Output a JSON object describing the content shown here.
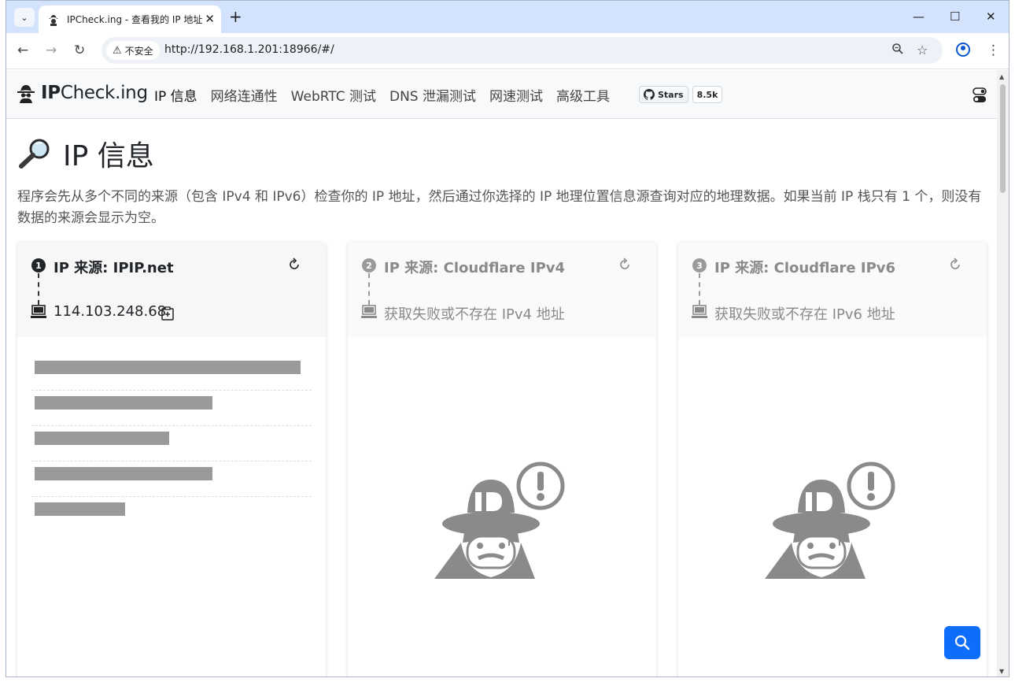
{
  "browser": {
    "tab_title": "IPCheck.ing - 查看我的 IP 地址",
    "tab_close": "✕",
    "new_tab": "+",
    "window_controls": {
      "minimize": "—",
      "maximize": "☐",
      "close": "✕"
    },
    "nav": {
      "back": "←",
      "forward": "→",
      "reload": "↻"
    },
    "security_label": "不安全",
    "url": "http://192.168.1.201:18966/#/",
    "icons": [
      "zoom-icon",
      "star-icon",
      "profile-icon",
      "menu-icon"
    ]
  },
  "site": {
    "brand_bold": "IP",
    "brand_rest": "Check.ing",
    "nav_items": [
      {
        "label": "IP 信息",
        "active": true
      },
      {
        "label": "网络连通性"
      },
      {
        "label": "WebRTC 测试"
      },
      {
        "label": "DNS 泄漏测试"
      },
      {
        "label": "网速测试"
      },
      {
        "label": "高级工具"
      }
    ],
    "github_stars_label": "Stars",
    "github_stars_count": "8.5k"
  },
  "page": {
    "title": "IP 信息",
    "intro": "程序会先从多个不同的来源（包含 IPv4 和 IPv6）检查你的 IP 地址，然后通过你选择的 IP 地理位置信息源查询对应的地理数据。如果当前 IP 栈只有 1 个，则没有数据的来源会显示为空。"
  },
  "cards": [
    {
      "step": "1",
      "source": "IP 来源: IPIP.net",
      "ip": "114.103.248.68",
      "status": "ok",
      "skeleton_rows": [
        0.97,
        0.65,
        0.49,
        0.65,
        0.33
      ]
    },
    {
      "step": "2",
      "source": "IP 来源: Cloudflare IPv4",
      "ip": "获取失败或不存在 IPv4 地址",
      "status": "missing"
    },
    {
      "step": "3",
      "source": "IP 来源: Cloudflare IPv6",
      "ip": "获取失败或不存在 IPv6 地址",
      "status": "missing"
    }
  ],
  "colors": {
    "accent": "#0d6efd",
    "skeleton": "#9a9a9a",
    "tabstrip": "#d3e3fd"
  }
}
